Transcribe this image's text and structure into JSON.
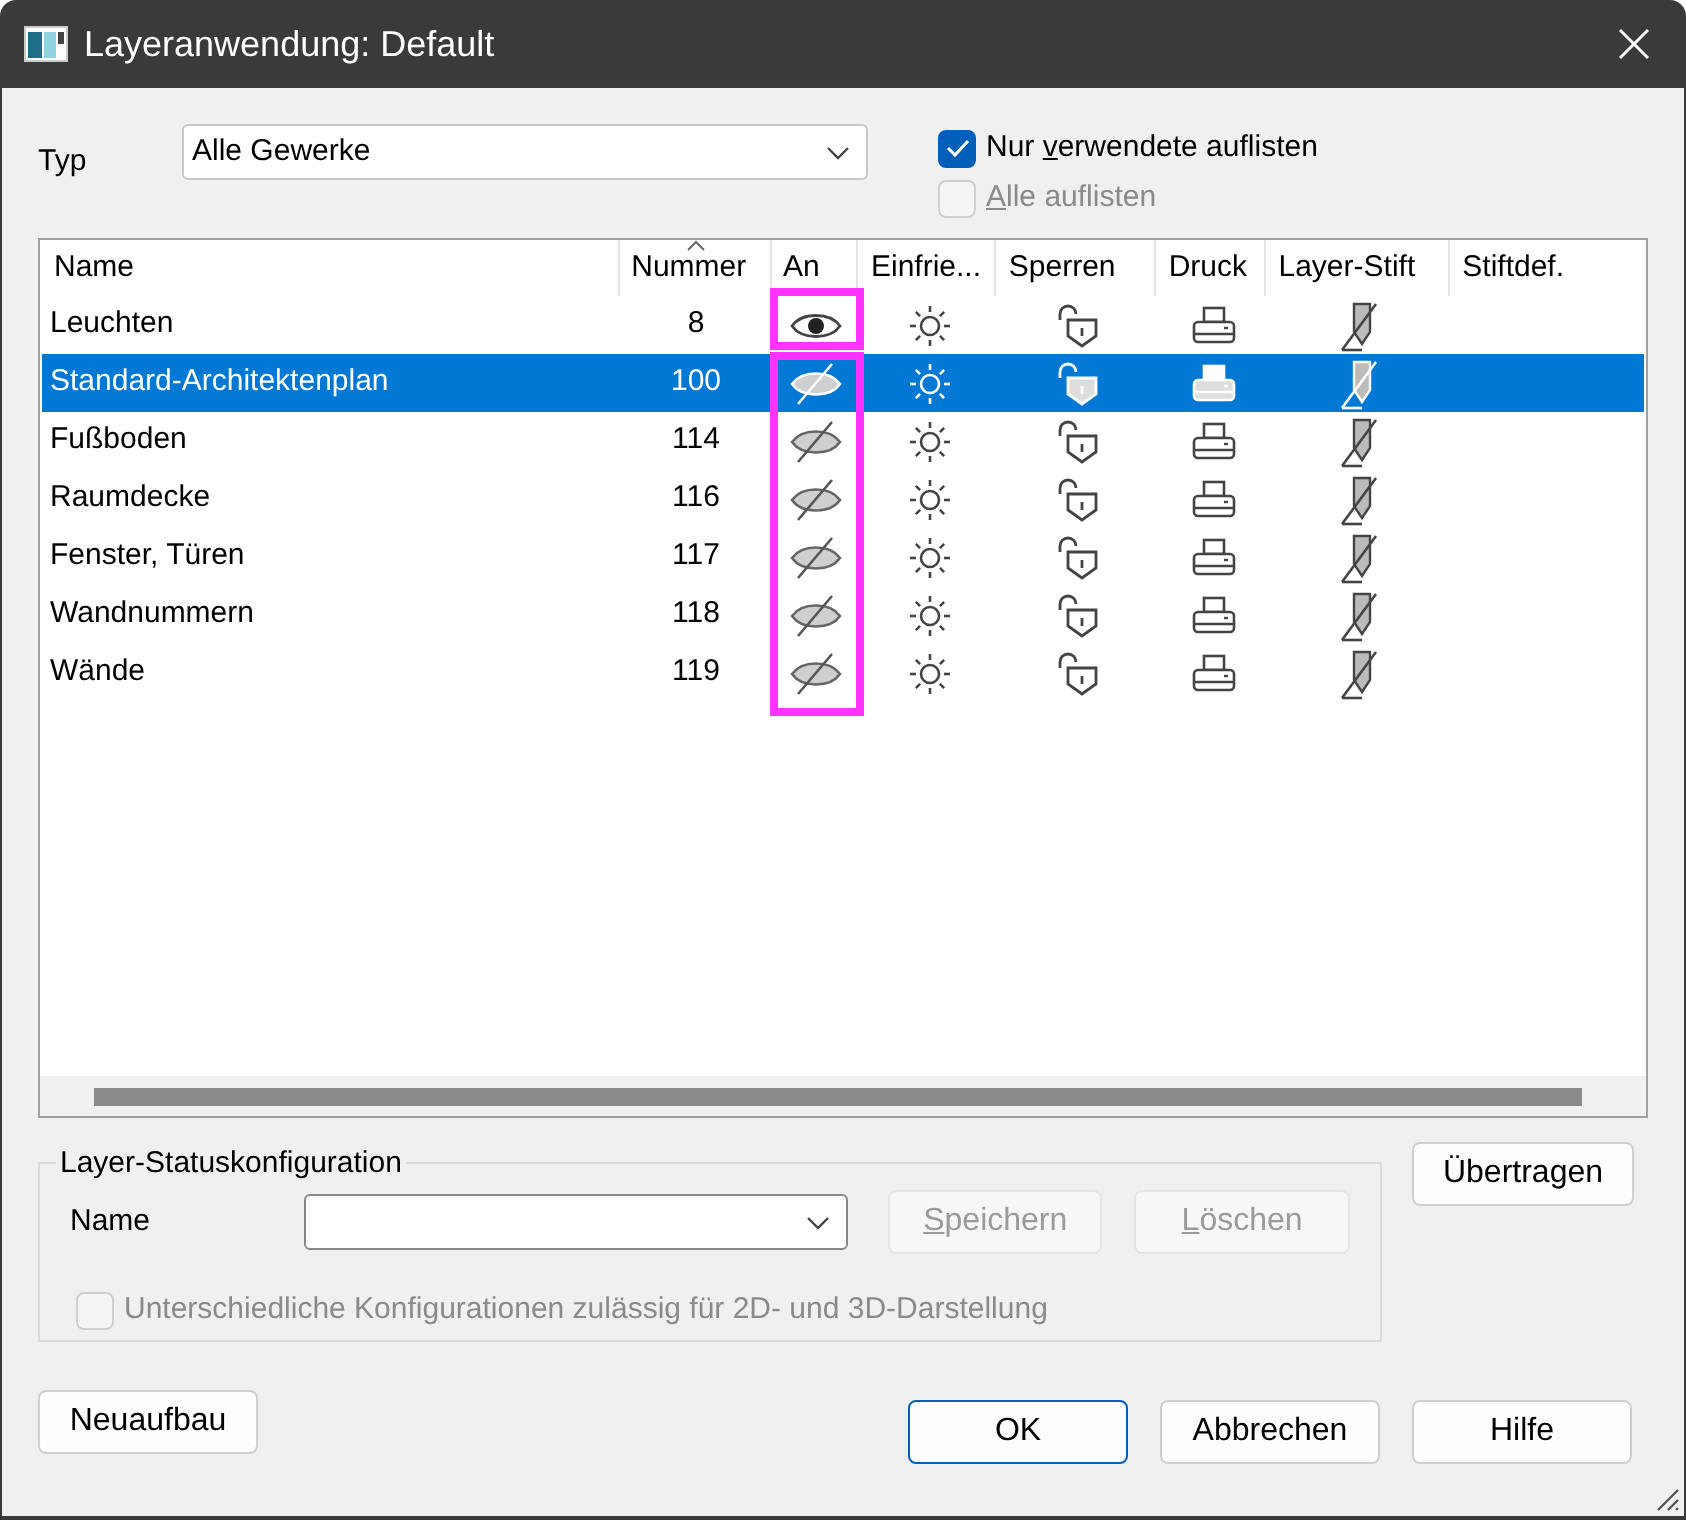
{
  "window": {
    "title": "Layeranwendung: Default"
  },
  "typ": {
    "label": "Typ",
    "value": "Alle Gewerke"
  },
  "options": [
    {
      "label": [
        {
          "text": "Nur ",
          "underlined": false
        },
        {
          "text": "v",
          "underlined": true
        },
        {
          "text": "erwendete auflisten",
          "underlined": false
        }
      ],
      "checked": true,
      "disabled": false
    },
    {
      "label": [
        {
          "text": "A",
          "underlined": true
        },
        {
          "text": "lle auflisten",
          "underlined": false
        }
      ],
      "checked": false,
      "disabled": true
    }
  ],
  "table": {
    "columns": [
      "Name",
      "Nummer",
      "An",
      "Einfrie...",
      "Sperren",
      "Druck",
      "Layer-Stift",
      "Stiftdef."
    ],
    "rows": [
      {
        "name": "Leuchten",
        "number": "8",
        "visible": true,
        "selected": false
      },
      {
        "name": "Standard-Architektenplan",
        "number": "100",
        "visible": false,
        "selected": true
      },
      {
        "name": "Fußboden",
        "number": "114",
        "visible": false,
        "selected": false
      },
      {
        "name": "Raumdecke",
        "number": "116",
        "visible": false,
        "selected": false
      },
      {
        "name": "Fenster, Türen",
        "number": "117",
        "visible": false,
        "selected": false
      },
      {
        "name": "Wandnummern",
        "number": "118",
        "visible": false,
        "selected": false
      },
      {
        "name": "Wände",
        "number": "119",
        "visible": false,
        "selected": false
      }
    ]
  },
  "status_config": {
    "title": "Layer-Statuskonfiguration",
    "name_label": "Name",
    "buttons": [
      {
        "label": [
          {
            "text": "S",
            "underlined": true
          },
          {
            "text": "peichern",
            "underlined": false
          }
        ],
        "disabled": true
      },
      {
        "label": [
          {
            "text": "L",
            "underlined": true
          },
          {
            "text": "öschen",
            "underlined": false
          }
        ],
        "disabled": true
      }
    ],
    "checkbox": {
      "label": "Unterschiedliche Konfigurationen zulässig für 2D- und 3D-Darstellung",
      "checked": false,
      "disabled": true
    }
  },
  "transfer_button": "Übertragen",
  "rebuild_button": "Neuaufbau",
  "dialog_buttons": [
    {
      "label": "OK",
      "default": true
    },
    {
      "label": "Abbrechen",
      "default": false
    },
    {
      "label": "Hilfe",
      "default": false
    }
  ]
}
